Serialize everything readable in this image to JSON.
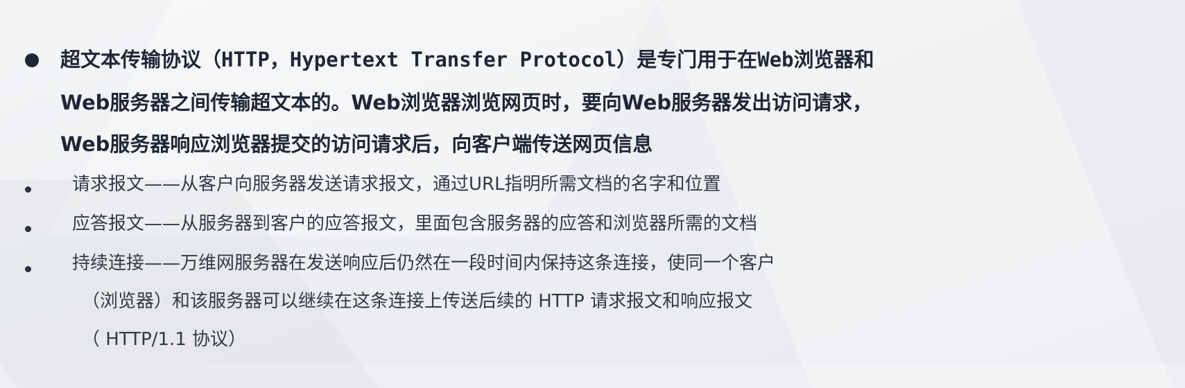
{
  "main_point": {
    "lines": [
      "超文本传输协议（HTTP，Hypertext Transfer Protocol）是专门用于在Web浏览器和",
      "Web服务器之间传输超文本的。Web浏览器浏览网页时，要向Web服务器发出访问请求，",
      "Web服务器响应浏览器提交的访问请求后，向客户端传送网页信息"
    ]
  },
  "sub_points": [
    {
      "lines": [
        "请求报文——从客户向服务器发送请求报文，通过URL指明所需文档的名字和位置"
      ]
    },
    {
      "lines": [
        "应答报文——从服务器到客户的应答报文，里面包含服务器的应答和浏览器所需的文档"
      ]
    },
    {
      "lines": [
        "持续连接——万维网服务器在发送响应后仍然在一段时间内保持这条连接，使同一个客户",
        "（浏览器）和该服务器可以继续在这条连接上传送后续的 HTTP 请求报文和响应报文",
        "（ HTTP/1.1 协议）"
      ]
    }
  ]
}
